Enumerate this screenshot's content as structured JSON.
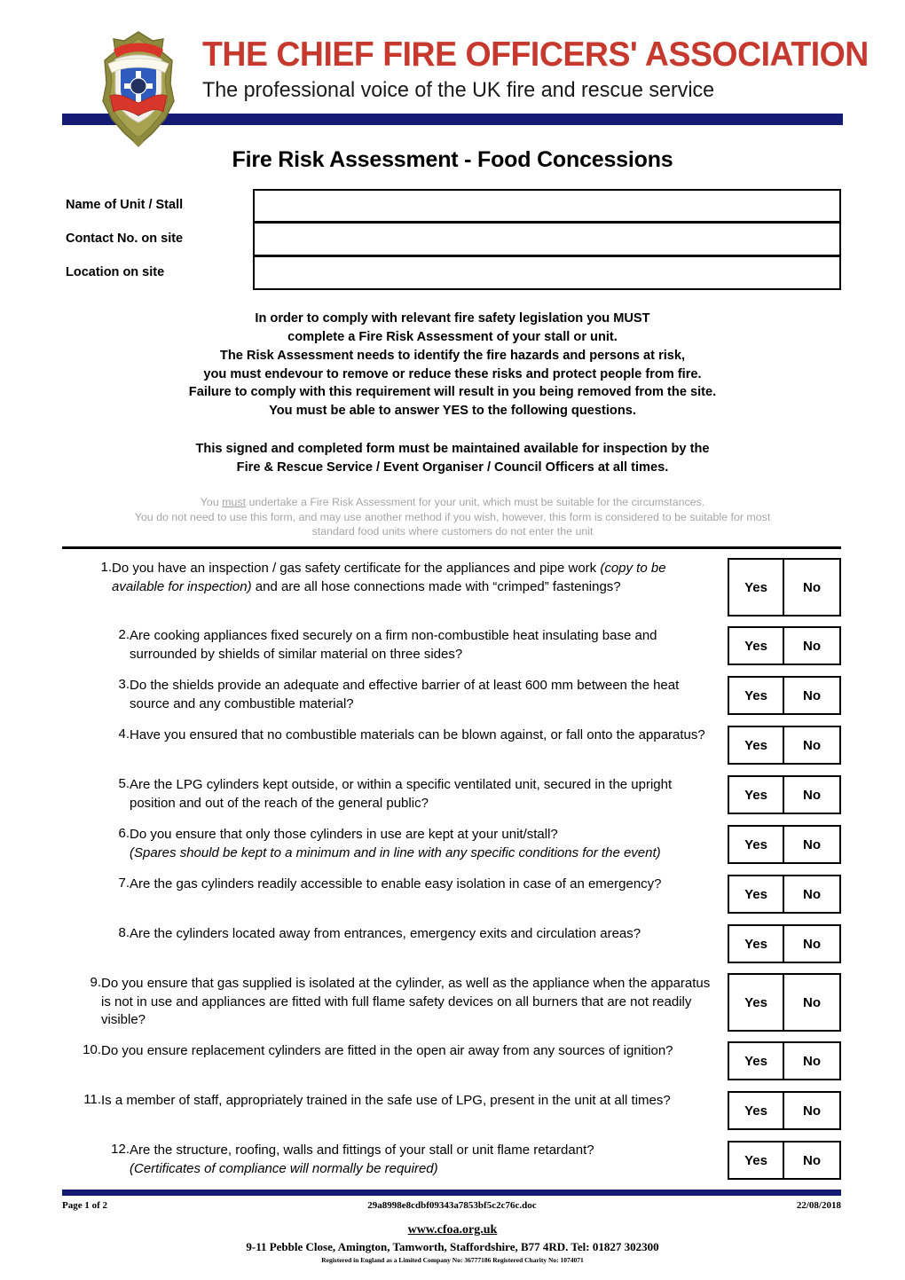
{
  "header": {
    "brand_title": "THE CHIEF FIRE OFFICERS' ASSOCIATION",
    "brand_subtitle": "The professional voice of the UK fire and rescue service",
    "logo_alt": "cfoa-crest-logo",
    "accent_red": "#C5392F",
    "accent_navy": "#151B73"
  },
  "document": {
    "title": "Fire Risk Assessment - Food Concessions"
  },
  "fields": [
    {
      "label": "Name of Unit / Stall",
      "value": "",
      "placeholder": ""
    },
    {
      "label": "Contact No. on site",
      "value": "",
      "placeholder": ""
    },
    {
      "label": "Location on site",
      "value": "",
      "placeholder": ""
    }
  ],
  "intro": {
    "para1_lines": [
      "In order to comply with relevant fire safety legislation you MUST",
      "complete a Fire Risk Assessment of your stall or unit.",
      "The Risk Assessment needs to identify the fire hazards and persons at risk,",
      "you must endevour to remove or reduce these risks and protect people from fire.",
      "Failure to comply with this requirement will result in you being removed from the site.",
      "You must be able to answer YES to the following questions."
    ],
    "para2_lines": [
      "This signed and completed form must be maintained available for inspection by the",
      "Fire & Rescue Service / Event Organiser / Council Officers at all times."
    ],
    "note_line1_a": "You ",
    "note_line1_underlined": "must",
    "note_line1_b": " undertake a Fire Risk Assessment for your unit, which must be suitable for the circumstances.",
    "note_line2": "You do not need to use this form, and may use another method if you wish, however, this form is considered to be suitable for most",
    "note_line3": "standard food units where customers do not enter the unit"
  },
  "answers": {
    "yes_label": "Yes",
    "no_label": "No"
  },
  "questions": [
    {
      "number": "1.",
      "text_main": "Do you have an inspection / gas safety certificate for the appliances and pipe work ",
      "text_italic": "(copy to be available for inspection)",
      "text_tail": " and are all hose connections made with “crimped” fastenings?"
    },
    {
      "number": "2.",
      "text_main": "Are cooking appliances fixed securely on a firm non-combustible heat insulating base and surrounded by shields of similar material on three sides?",
      "text_italic": "",
      "text_tail": ""
    },
    {
      "number": "3.",
      "text_main": "Do the shields provide an adequate and effective barrier of at least 600 mm between the heat source and any combustible material?",
      "text_italic": "",
      "text_tail": ""
    },
    {
      "number": "4.",
      "text_main": "Have you ensured that no combustible materials can be blown against, or fall onto the apparatus?",
      "text_italic": "",
      "text_tail": ""
    },
    {
      "number": "5.",
      "text_main": "Are the LPG cylinders kept outside, or within a specific ventilated unit, secured in the upright position and out of the reach of the general public?",
      "text_italic": "",
      "text_tail": ""
    },
    {
      "number": "6.",
      "text_main": "Do you ensure that only those cylinders in use are kept at your unit/stall?",
      "text_italic": "(Spares should be kept to a minimum and in line with any specific conditions for the event)",
      "text_tail": ""
    },
    {
      "number": "7.",
      "text_main": "Are the gas cylinders readily accessible to enable easy isolation in case of an emergency?",
      "text_italic": "",
      "text_tail": ""
    },
    {
      "number": "8.",
      "text_main": "Are the cylinders located away from entrances, emergency exits and circulation areas?",
      "text_italic": "",
      "text_tail": ""
    },
    {
      "number": "9.",
      "text_main": "Do you ensure that gas supplied is isolated at the cylinder, as well as the appliance when the apparatus is not in use and appliances are fitted with full flame safety devices on all burners that are not readily visible?",
      "text_italic": "",
      "text_tail": ""
    },
    {
      "number": "10.",
      "text_main": "Do you ensure replacement cylinders are fitted in the open air away from any sources of ignition?",
      "text_italic": "",
      "text_tail": ""
    },
    {
      "number": "11.",
      "text_main": "Is a member of staff, appropriately trained in the safe use of LPG, present in the unit at all times?",
      "text_italic": "",
      "text_tail": ""
    },
    {
      "number": "12.",
      "text_main": "Are the structure, roofing, walls and fittings of your stall or unit flame retardant?",
      "text_italic": "(Certificates of compliance will normally be required)",
      "text_tail": ""
    }
  ],
  "footer": {
    "page": "Page 1 of 2",
    "filename": "29a8998e8cdbf09343a7853bf5c2c76c.doc",
    "date": "22/08/2018",
    "website": "www.cfoa.org.uk",
    "address": "9-11 Pebble Close, Amington, Tamworth, Staffordshire, B77 4RD. Tel: 01827 302300",
    "registration": "Registered in England as a Limited Company No: 36777186 Registered Charity No: 1074071"
  }
}
